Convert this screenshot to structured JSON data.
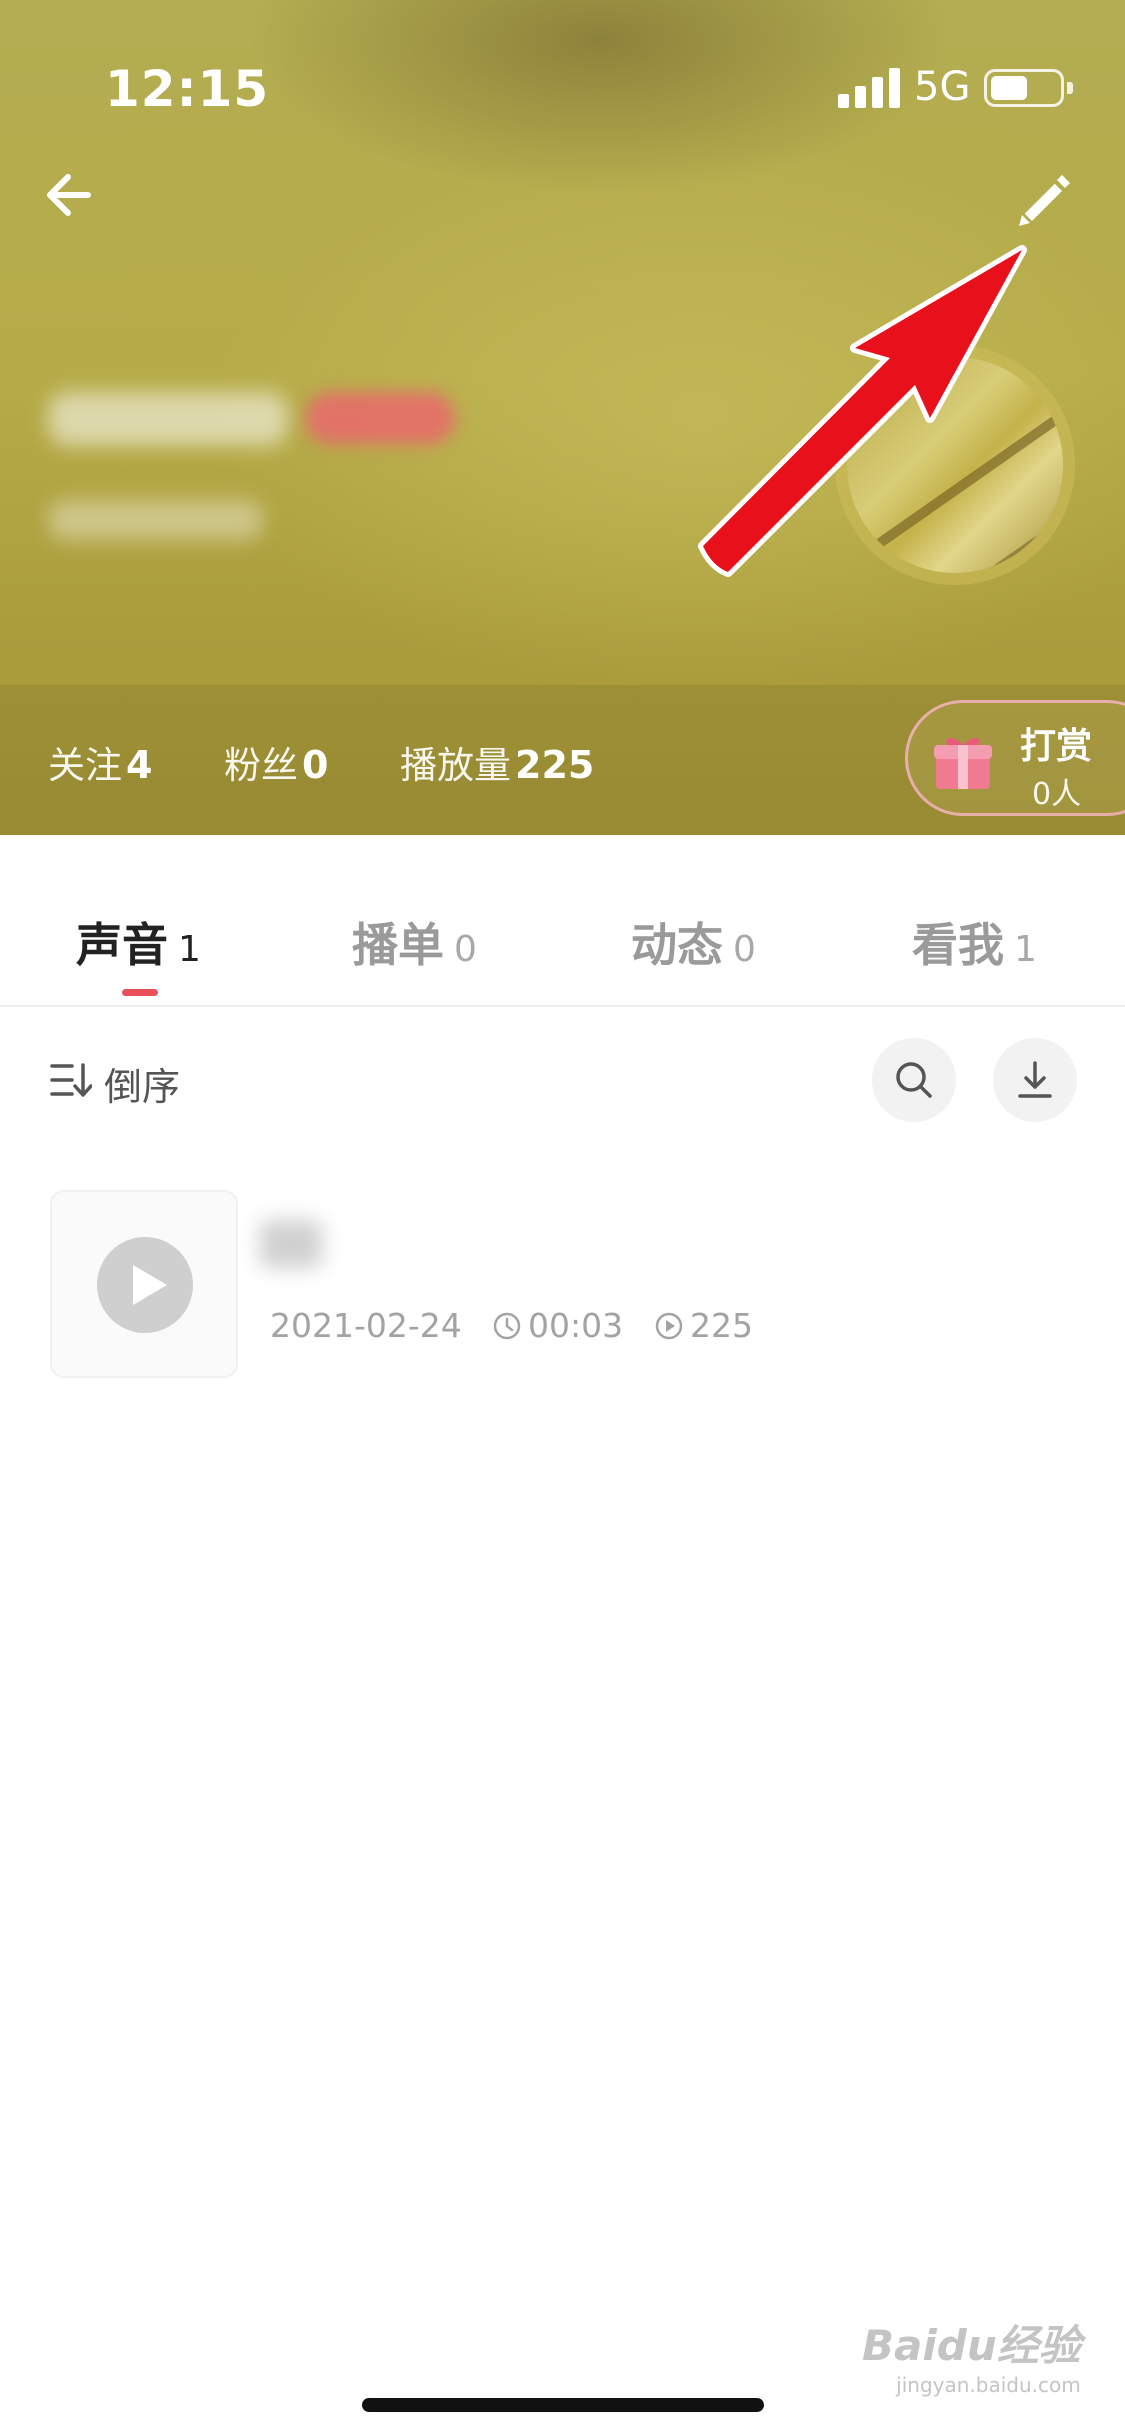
{
  "status_bar": {
    "time": "12:15",
    "network": "5G",
    "battery_level": 0.55
  },
  "header": {
    "stats": [
      {
        "label": "关注",
        "value": "4"
      },
      {
        "label": "粉丝",
        "value": "0"
      },
      {
        "label": "播放量",
        "value": "225"
      }
    ],
    "reward": {
      "label": "打赏",
      "count": "0人"
    }
  },
  "tabs": [
    {
      "label": "声音",
      "count": "1",
      "active": true
    },
    {
      "label": "播单",
      "count": "0",
      "active": false
    },
    {
      "label": "动态",
      "count": "0",
      "active": false
    },
    {
      "label": "看我",
      "count": "1",
      "active": false
    }
  ],
  "toolbar": {
    "sort_label": "倒序"
  },
  "tracks": [
    {
      "date": "2021-02-24",
      "duration": "00:03",
      "plays": "225"
    }
  ],
  "watermark": {
    "brand": "Baidu经验",
    "url": "jingyan.baidu.com"
  },
  "colors": {
    "accent": "#e8505b",
    "annotation_arrow": "#e8101a"
  },
  "icons": [
    "back-arrow-icon",
    "edit-pencil-icon",
    "gift-icon",
    "sort-icon",
    "search-icon",
    "download-icon",
    "play-icon",
    "clock-icon",
    "play-count-icon"
  ]
}
